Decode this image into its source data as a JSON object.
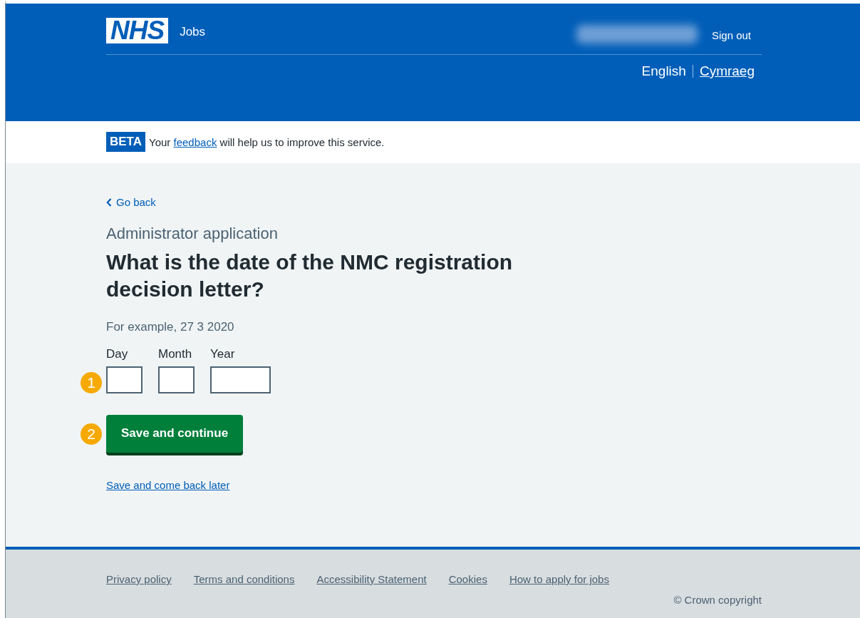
{
  "header": {
    "logo": "NHS",
    "service": "Jobs",
    "sign_out": "Sign out",
    "languages": [
      {
        "label": "English",
        "selected": true
      },
      {
        "label": "Cymraeg",
        "selected": false
      }
    ]
  },
  "beta_banner": {
    "tag": "BETA",
    "before": "Your ",
    "link": "feedback",
    "after": " will help us to improve this service."
  },
  "main": {
    "back_link": "Go back",
    "caption": "Administrator application",
    "question": "What is the date of the NMC registration decision letter?",
    "hint": "For example, 27 3 2020",
    "date_callout": "1",
    "date_fields": [
      {
        "label": "Day",
        "kind": "short"
      },
      {
        "label": "Month",
        "kind": "short"
      },
      {
        "label": "Year",
        "kind": "long"
      }
    ],
    "primary_button": {
      "label": "Save and continue",
      "callout": "2"
    },
    "secondary_link": "Save and come back later"
  },
  "footer": {
    "links": [
      "Privacy policy",
      "Terms and conditions",
      "Accessibility Statement",
      "Cookies",
      "How to apply for jobs"
    ],
    "copyright": "© Crown copyright"
  }
}
